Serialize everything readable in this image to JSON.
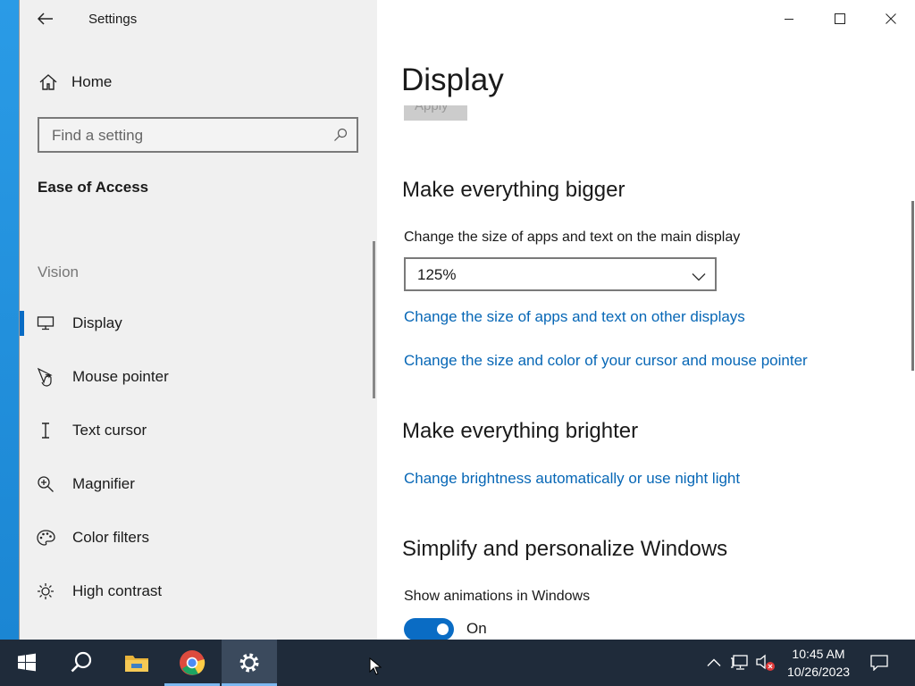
{
  "window": {
    "app_title": "Settings"
  },
  "sidebar": {
    "home_label": "Home",
    "search_placeholder": "Find a setting",
    "category": "Ease of Access",
    "section_label": "Vision",
    "items": [
      {
        "label": "Display",
        "icon": "monitor-icon",
        "selected": true
      },
      {
        "label": "Mouse pointer",
        "icon": "mouse-pointer-icon",
        "selected": false
      },
      {
        "label": "Text cursor",
        "icon": "text-cursor-icon",
        "selected": false
      },
      {
        "label": "Magnifier",
        "icon": "magnifier-icon",
        "selected": false
      },
      {
        "label": "Color filters",
        "icon": "color-filters-icon",
        "selected": false
      },
      {
        "label": "High contrast",
        "icon": "high-contrast-icon",
        "selected": false
      }
    ]
  },
  "main": {
    "page_title": "Display",
    "apply_label": "Apply",
    "sections": {
      "bigger": {
        "heading": "Make everything bigger",
        "description": "Change the size of apps and text on the main display",
        "dropdown_value": "125%",
        "link1": "Change the size of apps and text on other displays",
        "link2": "Change the size and color of your cursor and mouse pointer"
      },
      "brighter": {
        "heading": "Make everything brighter",
        "link1": "Change brightness automatically or use night light"
      },
      "simplify": {
        "heading": "Simplify and personalize Windows",
        "animations_label": "Show animations in Windows",
        "animations_state": "On"
      }
    }
  },
  "taskbar": {
    "time": "10:45 AM",
    "date": "10/26/2023",
    "apps": [
      "start",
      "search",
      "file-explorer",
      "chrome",
      "settings"
    ]
  },
  "colors": {
    "accent": "#0a6cc4",
    "link": "#0767b6",
    "taskbar": "#1f2b3a",
    "sidebar_bg": "#f0f0f0"
  }
}
